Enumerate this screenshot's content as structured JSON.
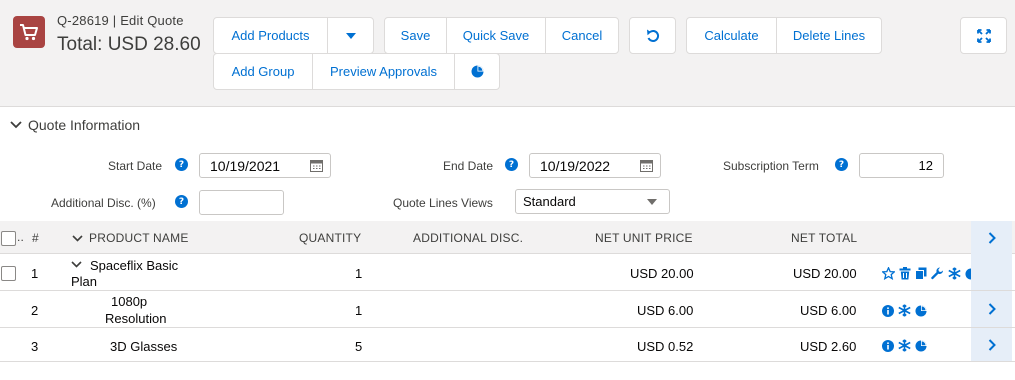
{
  "header": {
    "quote_id": "Q-28619 | Edit Quote",
    "total": "Total: USD 28.60"
  },
  "toolbar": {
    "add_products": "Add Products",
    "save": "Save",
    "quick_save": "Quick Save",
    "cancel": "Cancel",
    "calculate": "Calculate",
    "delete_lines": "Delete Lines",
    "add_group": "Add Group",
    "preview_approvals": "Preview Approvals"
  },
  "section": {
    "title": "Quote Information"
  },
  "fields": {
    "start_date_label": "Start Date",
    "start_date_value": "10/19/2021",
    "end_date_label": "End Date",
    "end_date_value": "10/19/2022",
    "subscription_term_label": "Subscription Term",
    "subscription_term_value": "12",
    "additional_disc_label": "Additional Disc. (%)",
    "additional_disc_value": "",
    "quote_lines_views_label": "Quote Lines Views",
    "quote_lines_views_value": "Standard"
  },
  "table": {
    "columns": {
      "row_number": "#",
      "product_name": "PRODUCT NAME",
      "quantity": "QUANTITY",
      "additional_disc": "ADDITIONAL DISC.",
      "net_unit_price": "NET UNIT PRICE",
      "net_total": "NET TOTAL"
    },
    "rows": [
      {
        "num": "1",
        "name_line1": "Spaceflix Basic",
        "name_line2": "Plan",
        "quantity": "1",
        "additional_disc": "",
        "net_unit_price": "USD 20.00",
        "net_total": "USD 20.00"
      },
      {
        "num": "2",
        "name_line1": "1080p",
        "name_line2": "Resolution",
        "quantity": "1",
        "additional_disc": "",
        "net_unit_price": "USD 6.00",
        "net_total": "USD 6.00"
      },
      {
        "num": "3",
        "name_line1": "3D Glasses",
        "name_line2": "",
        "quantity": "5",
        "additional_disc": "",
        "net_unit_price": "USD 0.52",
        "net_total": "USD 2.60"
      }
    ]
  },
  "colors": {
    "brand_link": "#0070d2",
    "app_icon_bg": "#a94442",
    "header_bg": "#f3f2f2"
  }
}
